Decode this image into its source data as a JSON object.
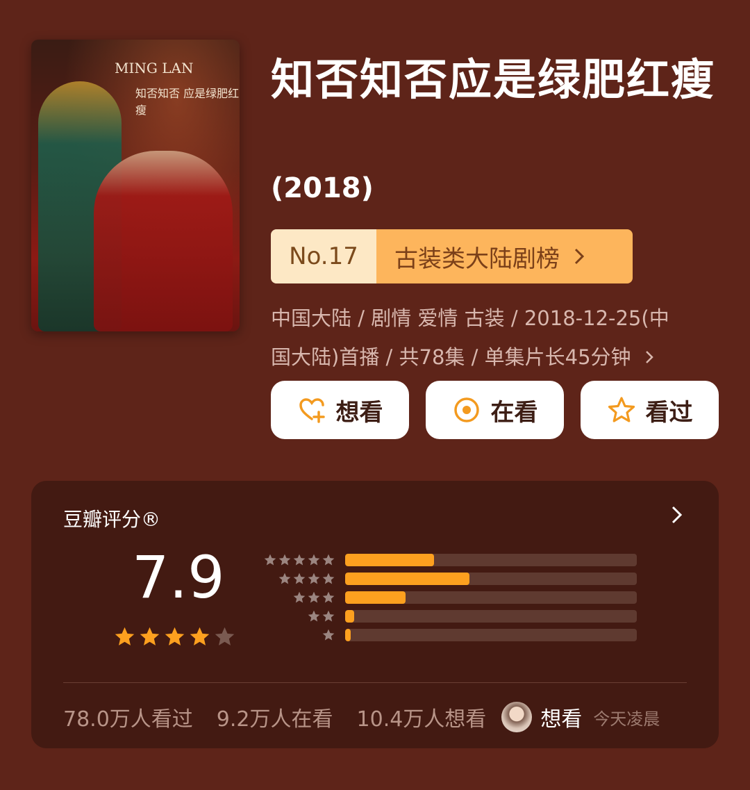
{
  "movie": {
    "title": "知否知否应是绿肥红瘦",
    "year": "(2018)",
    "poster_title": "MING LAN",
    "poster_subtitle": "知否知否 应是绿肥红瘦"
  },
  "rank": {
    "no": "No.17",
    "list_name": "古装类大陆剧榜"
  },
  "meta": {
    "line1": "中国大陆 / 剧情 爱情 古装 / 2018-12-25(中",
    "line2": "国大陆)首播 / 共78集 / 单集片长45分钟"
  },
  "actions": {
    "want": "想看",
    "watching": "在看",
    "watched": "看过"
  },
  "rating": {
    "label": "豆瓣评分®",
    "score": "7.9",
    "stars": 4,
    "distribution": [
      {
        "stars": 5,
        "percent": 30.5
      },
      {
        "stars": 4,
        "percent": 42.5
      },
      {
        "stars": 3,
        "percent": 20.7
      },
      {
        "stars": 2,
        "percent": 3.2
      },
      {
        "stars": 1,
        "percent": 2.0
      }
    ]
  },
  "stats": {
    "watched": "78.0万人看过",
    "watching": "9.2万人在看",
    "want": "10.4万人想看",
    "recent_action": "想看",
    "recent_time": "今天凌晨"
  },
  "colors": {
    "background": "#5e2419",
    "accent": "#fda01f",
    "card": "#431a12"
  }
}
